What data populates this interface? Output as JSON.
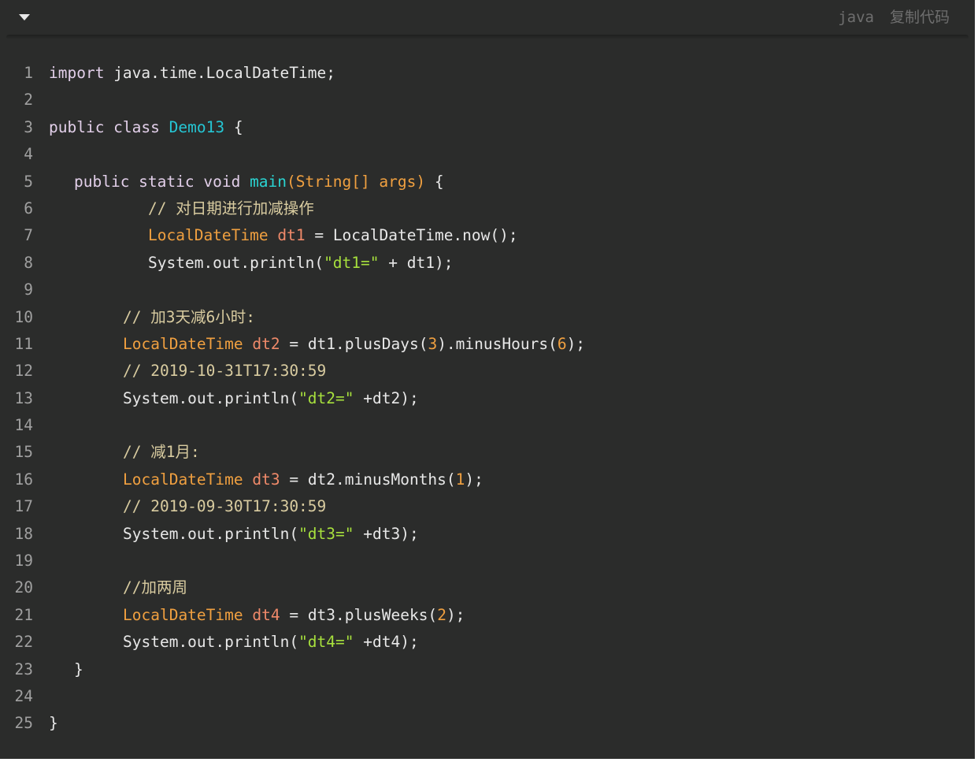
{
  "toolbar": {
    "language": "java",
    "copy_label": "复制代码",
    "collapse_icon": "caret-down-icon"
  },
  "colors": {
    "background": "#2b2c2b",
    "line_number": "#a0a0a0",
    "keyword": "#e2cfe9",
    "class_name": "#25c6d4",
    "type": "#f0a040",
    "variable": "#f08a6a",
    "string": "#a7e03d",
    "comment": "#d9cca0"
  },
  "code": {
    "lines": [
      {
        "n": "1",
        "indent": 0,
        "tokens": [
          [
            "kw",
            "import"
          ],
          [
            "plain",
            " java.time.LocalDateTime;"
          ]
        ]
      },
      {
        "n": "2",
        "indent": 0,
        "tokens": []
      },
      {
        "n": "3",
        "indent": 0,
        "tokens": [
          [
            "kw",
            "public class "
          ],
          [
            "cls",
            "Demo13"
          ],
          [
            "plain",
            " {"
          ]
        ]
      },
      {
        "n": "4",
        "indent": 0,
        "tokens": []
      },
      {
        "n": "5",
        "indent": 1,
        "tokens": [
          [
            "kw",
            "public static void "
          ],
          [
            "fn",
            "main"
          ],
          [
            "param",
            "(String[] args)"
          ],
          [
            "plain",
            " {"
          ]
        ]
      },
      {
        "n": "6",
        "indent": 2,
        "tokens": [
          [
            "cmt",
            "// 对日期进行加减操作"
          ]
        ]
      },
      {
        "n": "7",
        "indent": 2,
        "tokens": [
          [
            "type",
            "LocalDateTime"
          ],
          [
            "var",
            " dt1"
          ],
          [
            "plain",
            " = LocalDateTime.now();"
          ]
        ]
      },
      {
        "n": "8",
        "indent": 2,
        "tokens": [
          [
            "plain",
            "System.out.println("
          ],
          [
            "str",
            "\"dt1=\""
          ],
          [
            "plain",
            " + dt1);"
          ]
        ]
      },
      {
        "n": "9",
        "indent": 0,
        "tokens": []
      },
      {
        "n": "10",
        "indent": 3,
        "tokens": [
          [
            "cmt",
            "// 加3天减6小时:"
          ]
        ]
      },
      {
        "n": "11",
        "indent": 3,
        "tokens": [
          [
            "type",
            "LocalDateTime"
          ],
          [
            "var",
            " dt2"
          ],
          [
            "plain",
            " = dt1.plusDays("
          ],
          [
            "num",
            "3"
          ],
          [
            "plain",
            ").minusHours("
          ],
          [
            "num",
            "6"
          ],
          [
            "plain",
            ");"
          ]
        ]
      },
      {
        "n": "12",
        "indent": 3,
        "tokens": [
          [
            "cmt",
            "// 2019-10-31T17:30:59"
          ]
        ]
      },
      {
        "n": "13",
        "indent": 3,
        "tokens": [
          [
            "plain",
            "System.out.println("
          ],
          [
            "str",
            "\"dt2=\""
          ],
          [
            "plain",
            " +dt2);"
          ]
        ]
      },
      {
        "n": "14",
        "indent": 0,
        "tokens": []
      },
      {
        "n": "15",
        "indent": 3,
        "tokens": [
          [
            "cmt",
            "// 减1月:"
          ]
        ]
      },
      {
        "n": "16",
        "indent": 3,
        "tokens": [
          [
            "type",
            "LocalDateTime"
          ],
          [
            "var",
            " dt3"
          ],
          [
            "plain",
            " = dt2.minusMonths("
          ],
          [
            "num",
            "1"
          ],
          [
            "plain",
            ");"
          ]
        ]
      },
      {
        "n": "17",
        "indent": 3,
        "tokens": [
          [
            "cmt",
            "// 2019-09-30T17:30:59"
          ]
        ]
      },
      {
        "n": "18",
        "indent": 3,
        "tokens": [
          [
            "plain",
            "System.out.println("
          ],
          [
            "str",
            "\"dt3=\""
          ],
          [
            "plain",
            " +dt3);"
          ]
        ]
      },
      {
        "n": "19",
        "indent": 0,
        "tokens": []
      },
      {
        "n": "20",
        "indent": 3,
        "tokens": [
          [
            "cmt",
            "//加两周"
          ]
        ]
      },
      {
        "n": "21",
        "indent": 3,
        "tokens": [
          [
            "type",
            "LocalDateTime"
          ],
          [
            "var",
            " dt4"
          ],
          [
            "plain",
            " = dt3.plusWeeks("
          ],
          [
            "num",
            "2"
          ],
          [
            "plain",
            ");"
          ]
        ]
      },
      {
        "n": "22",
        "indent": 3,
        "tokens": [
          [
            "plain",
            "System.out.println("
          ],
          [
            "str",
            "\"dt4=\""
          ],
          [
            "plain",
            " +dt4);"
          ]
        ]
      },
      {
        "n": "23",
        "indent": 1,
        "tokens": [
          [
            "plain",
            "}"
          ]
        ]
      },
      {
        "n": "24",
        "indent": 0,
        "tokens": []
      },
      {
        "n": "25",
        "indent": 0,
        "tokens": [
          [
            "plain",
            "}"
          ]
        ]
      }
    ]
  }
}
